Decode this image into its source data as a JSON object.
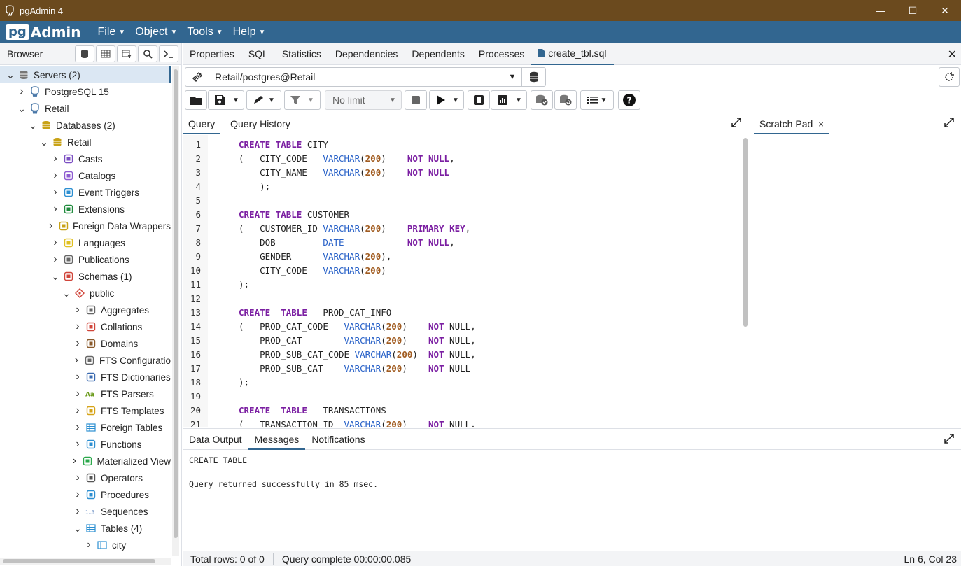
{
  "window": {
    "title": "pgAdmin 4",
    "controls": {
      "minimize": "—",
      "maximize": "☐",
      "close": "✕"
    }
  },
  "menubar": {
    "logo_pg": "pg",
    "logo_admin": "Admin",
    "items": [
      {
        "label": "File"
      },
      {
        "label": "Object"
      },
      {
        "label": "Tools"
      },
      {
        "label": "Help"
      }
    ]
  },
  "browser": {
    "title": "Browser",
    "tree": [
      {
        "label": "Servers (2)",
        "icon": "servers-icon",
        "expanded": true,
        "selected": true
      },
      {
        "label": "PostgreSQL 15",
        "icon": "elephant-icon",
        "expanded": false
      },
      {
        "label": "Retail",
        "icon": "elephant-icon",
        "expanded": true
      },
      {
        "label": "Databases (2)",
        "icon": "database-icon",
        "expanded": true
      },
      {
        "label": "Retail",
        "icon": "database-icon",
        "expanded": true
      },
      {
        "label": "Casts",
        "icon": "casts-icon",
        "expanded": false
      },
      {
        "label": "Catalogs",
        "icon": "catalogs-icon",
        "expanded": false
      },
      {
        "label": "Event Triggers",
        "icon": "event-triggers-icon",
        "expanded": false
      },
      {
        "label": "Extensions",
        "icon": "extensions-icon",
        "expanded": false
      },
      {
        "label": "Foreign Data Wrappers",
        "icon": "foreign-data-wrappers-icon",
        "expanded": false
      },
      {
        "label": "Languages",
        "icon": "languages-icon",
        "expanded": false
      },
      {
        "label": "Publications",
        "icon": "publications-icon",
        "expanded": false
      },
      {
        "label": "Schemas (1)",
        "icon": "schemas-icon",
        "expanded": true
      },
      {
        "label": "public",
        "icon": "schema-icon",
        "expanded": true
      },
      {
        "label": "Aggregates",
        "icon": "aggregates-icon",
        "expanded": false
      },
      {
        "label": "Collations",
        "icon": "collations-icon",
        "expanded": false
      },
      {
        "label": "Domains",
        "icon": "domains-icon",
        "expanded": false
      },
      {
        "label": "FTS Configuratio",
        "icon": "fts-configurations-icon",
        "expanded": false
      },
      {
        "label": "FTS Dictionaries",
        "icon": "fts-dictionaries-icon",
        "expanded": false
      },
      {
        "label": "FTS Parsers",
        "icon": "fts-parsers-icon",
        "expanded": false
      },
      {
        "label": "FTS Templates",
        "icon": "fts-templates-icon",
        "expanded": false
      },
      {
        "label": "Foreign Tables",
        "icon": "foreign-tables-icon",
        "expanded": false
      },
      {
        "label": "Functions",
        "icon": "functions-icon",
        "expanded": false
      },
      {
        "label": "Materialized View",
        "icon": "materialized-views-icon",
        "expanded": false
      },
      {
        "label": "Operators",
        "icon": "operators-icon",
        "expanded": false
      },
      {
        "label": "Procedures",
        "icon": "procedures-icon",
        "expanded": false
      },
      {
        "label": "Sequences",
        "icon": "sequences-icon",
        "expanded": false
      },
      {
        "label": "Tables (4)",
        "icon": "tables-icon",
        "expanded": true
      },
      {
        "label": "city",
        "icon": "table-icon",
        "expanded": false
      }
    ]
  },
  "main_tabs": [
    {
      "label": "Properties"
    },
    {
      "label": "SQL"
    },
    {
      "label": "Statistics"
    },
    {
      "label": "Dependencies"
    },
    {
      "label": "Dependents"
    },
    {
      "label": "Processes"
    },
    {
      "label": "create_tbl.sql",
      "active": true
    }
  ],
  "connection": {
    "label": "Retail/postgres@Retail"
  },
  "toolbar": {
    "limit": "No limit"
  },
  "editor_tabs": [
    {
      "label": "Query",
      "active": true
    },
    {
      "label": "Query History"
    }
  ],
  "scratch_pad": {
    "label": "Scratch Pad",
    "close": "×"
  },
  "code_lines": [
    "1",
    "2",
    "3",
    "4",
    "5",
    "6",
    "7",
    "8",
    "9",
    "10",
    "11",
    "12",
    "13",
    "14",
    "15",
    "16",
    "17",
    "18",
    "19",
    "20",
    "21"
  ],
  "code": {
    "l1": [
      "CREATE TABLE",
      " CITY"
    ],
    "l2": [
      "(   CITY_CODE   ",
      "VARCHAR",
      "(",
      "200",
      ")    ",
      "NOT NULL",
      ","
    ],
    "l3": [
      "    CITY_NAME   ",
      "VARCHAR",
      "(",
      "200",
      ")    ",
      "NOT NULL"
    ],
    "l4": [
      "    );"
    ],
    "l6": [
      "CREATE TABLE",
      " CUSTOMER"
    ],
    "l7": [
      "(   CUSTOMER_ID ",
      "VARCHAR",
      "(",
      "200",
      ")    ",
      "PRIMARY KEY",
      ","
    ],
    "l8": [
      "    DOB         ",
      "DATE",
      "            ",
      "NOT NULL",
      ","
    ],
    "l9": [
      "    GENDER      ",
      "VARCHAR",
      "(",
      "200",
      "),"
    ],
    "l10": [
      "    CITY_CODE   ",
      "VARCHAR",
      "(",
      "200",
      ")"
    ],
    "l11": [
      ");"
    ],
    "l13": [
      "CREATE",
      "  ",
      "TABLE",
      "   PROD_CAT_INFO"
    ],
    "l14": [
      "(   PROD_CAT_CODE   ",
      "VARCHAR",
      "(",
      "200",
      ")    ",
      "NOT",
      " NULL,"
    ],
    "l15": [
      "    PROD_CAT        ",
      "VARCHAR",
      "(",
      "200",
      ")    ",
      "NOT",
      " NULL,"
    ],
    "l16": [
      "    PROD_SUB_CAT_CODE ",
      "VARCHAR",
      "(",
      "200",
      ")  ",
      "NOT",
      " NULL,"
    ],
    "l17": [
      "    PROD_SUB_CAT    ",
      "VARCHAR",
      "(",
      "200",
      ")    ",
      "NOT",
      " NULL"
    ],
    "l18": [
      ");"
    ],
    "l20": [
      "CREATE",
      "  ",
      "TABLE",
      "   TRANSACTIONS"
    ],
    "l21": [
      "(   TRANSACTION_ID  ",
      "VARCHAR",
      "(",
      "200",
      ")    ",
      "NOT",
      " NULL,"
    ]
  },
  "output_tabs": [
    {
      "label": "Data Output"
    },
    {
      "label": "Messages",
      "active": true
    },
    {
      "label": "Notifications"
    }
  ],
  "messages": {
    "line1": "CREATE TABLE",
    "line2": "Query returned successfully in 85 msec."
  },
  "status": {
    "rows": "Total rows: 0 of 0",
    "query": "Query complete 00:00:00.085",
    "cursor": "Ln 6, Col 23"
  },
  "colors": {
    "title_bar": "#6b4a1e",
    "menu_bar": "#326690",
    "keyword": "#7b1fa2",
    "type": "#2962c8",
    "number": "#a15c21"
  }
}
